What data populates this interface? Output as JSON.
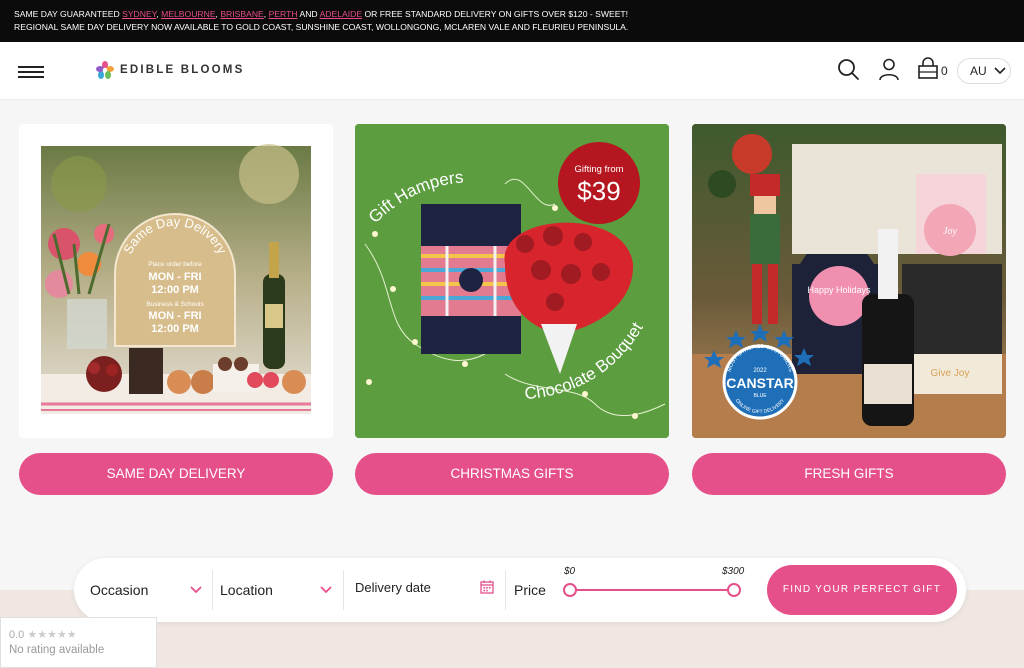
{
  "announcement": {
    "line1_prefix": "SAME DAY GUARANTEED",
    "cities": [
      "SYDNEY",
      "MELBOURNE",
      "BRISBANE",
      "PERTH",
      "ADELAIDE"
    ],
    "line1_and": "AND",
    "line1_suffix": "OR FREE STANDARD DELIVERY ON GIFTS OVER $120 - SWEET!",
    "line2": "REGIONAL SAME DAY DELIVERY NOW AVAILABLE TO GOLD COAST, SUNSHINE COAST, WOLLONGONG, MCLAREN VALE AND FLEURIEU PENINSULA."
  },
  "header": {
    "logo_text": "EDIBLE BLOOMS",
    "cart_count": "0",
    "region": "AU",
    "icons": [
      "menu-icon",
      "search-icon",
      "account-icon",
      "cart-icon",
      "chevron-down-icon"
    ]
  },
  "cards": [
    {
      "label": "SAME DAY DELIVERY",
      "badge_title": "Same Day Delivery",
      "badge_l1": "Place order before",
      "badge_l2": "MON - FRI",
      "badge_l3": "12:00 PM",
      "badge_l4": "Business & Schools",
      "badge_l5": "MON - FRI",
      "badge_l6": "12:00 PM"
    },
    {
      "label": "CHRISTMAS GIFTS",
      "promo_top": "Gifting from",
      "promo_price": "$39",
      "curve_text_1": "Gift Hampers",
      "curve_text_2": "Chocolate Bouquets"
    },
    {
      "label": "FRESH GIFTS",
      "tag_text": "Happy Holidays",
      "award_name": "CANSTAR",
      "award_year": "2022",
      "award_sub": "BLUE",
      "award_arc_top": "MOST SATISFIED CUSTOMERS",
      "award_arc_bottom": "ONLINE GIFT DELIVERY",
      "box_text": "Give Joy",
      "box_tag_text": "Joy"
    }
  ],
  "filter": {
    "occasion": "Occasion",
    "location": "Location",
    "delivery_date": "Delivery date",
    "price_label": "Price",
    "price_min": "$0",
    "price_max": "$300",
    "price_range_selected": [
      0,
      300
    ],
    "cta": "FIND YOUR PERFECT GIFT"
  },
  "rating_widget": {
    "score": "0.0",
    "stars": "★★★★★",
    "text": "No rating available"
  },
  "colors": {
    "accent": "#e5508b",
    "announce_bg": "#0b0b0b",
    "link": "#e84d8a",
    "christmas_green": "#5c9d3f",
    "promo_red": "#b5161f"
  }
}
